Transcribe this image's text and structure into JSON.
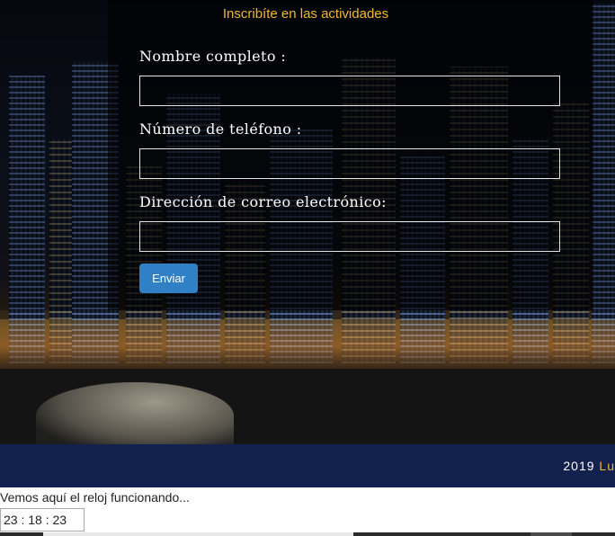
{
  "form": {
    "title": "Inscribíte en las actividades",
    "name_label": "Nombre completo :",
    "name_value": "",
    "phone_label": "Número de teléfono :",
    "phone_value": "",
    "email_label": "Dirección de correo electrónico:",
    "email_value": "",
    "submit_label": "Enviar"
  },
  "footer": {
    "year": "2019",
    "text_gold": "Lu"
  },
  "clock": {
    "caption": "Vemos aquí el reloj funcionando...",
    "time": "23 : 18 : 23"
  },
  "colors": {
    "accent_gold": "#f1b82d",
    "button_blue": "#2f80c4",
    "footer_navy": "#12214e"
  }
}
